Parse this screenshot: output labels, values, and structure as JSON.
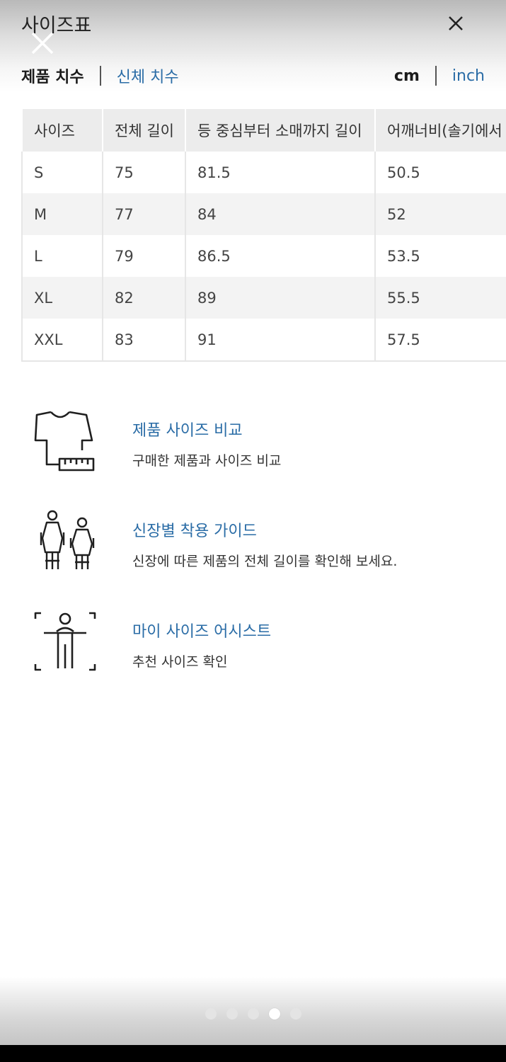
{
  "header": {
    "title": "사이즈표"
  },
  "tabs": {
    "product": "제품 치수",
    "body": "신체 치수"
  },
  "units": {
    "cm": "cm",
    "inch": "inch"
  },
  "table": {
    "headers": [
      "사이즈",
      "전체 길이",
      "등 중심부터 소매까지 길이",
      "어깨너비(솔기에서"
    ],
    "rows": [
      [
        "S",
        "75",
        "81.5",
        "50.5"
      ],
      [
        "M",
        "77",
        "84",
        "52"
      ],
      [
        "L",
        "79",
        "86.5",
        "53.5"
      ],
      [
        "XL",
        "82",
        "89",
        "55.5"
      ],
      [
        "XXL",
        "83",
        "91",
        "57.5"
      ]
    ]
  },
  "tools": [
    {
      "title": "제품 사이즈 비교",
      "desc": "구매한 제품과 사이즈 비교",
      "icon": "shirt-ruler-icon"
    },
    {
      "title": "신장별 착용 가이드",
      "desc": "신장에 따른 제품의 전체 길이를 확인해 보세요.",
      "icon": "two-people-icon"
    },
    {
      "title": "마이 사이즈 어시스트",
      "desc": "추천 사이즈 확인",
      "icon": "body-scan-icon"
    }
  ],
  "pager": {
    "count": 5,
    "active_index": 3
  }
}
